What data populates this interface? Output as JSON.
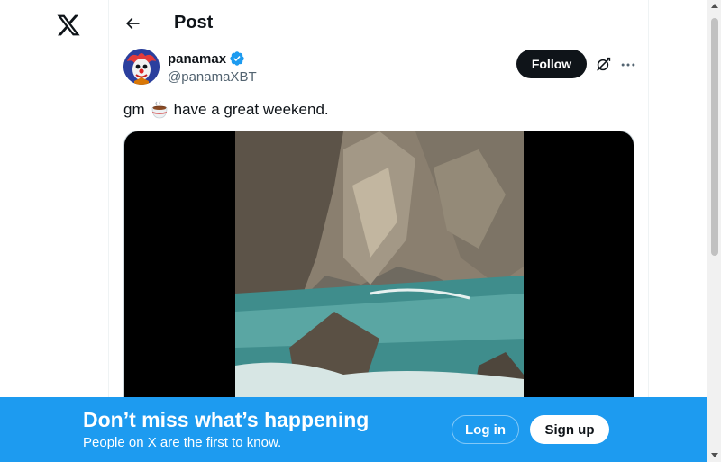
{
  "app": {
    "logo_icon": "x-logo-icon"
  },
  "header": {
    "title": "Post",
    "back_icon": "arrow-left-icon"
  },
  "post": {
    "author": {
      "display_name": "panamax",
      "handle": "@panamaXBT",
      "verified": true,
      "verified_color": "#1d9bf0"
    },
    "follow_label": "Follow",
    "actions": {
      "grok_icon": "grok-icon",
      "more_icon": "more-horizontal-icon"
    },
    "text_before_emoji": "gm",
    "emoji": "hot-beverage-emoji",
    "text_after_emoji": "have a great weekend.",
    "media": {
      "type": "video"
    }
  },
  "bottom_bar": {
    "title": "Don’t miss what’s happening",
    "subtitle": "People on X are the first to know.",
    "login_label": "Log in",
    "signup_label": "Sign up",
    "background_color": "#1d9bf0"
  }
}
